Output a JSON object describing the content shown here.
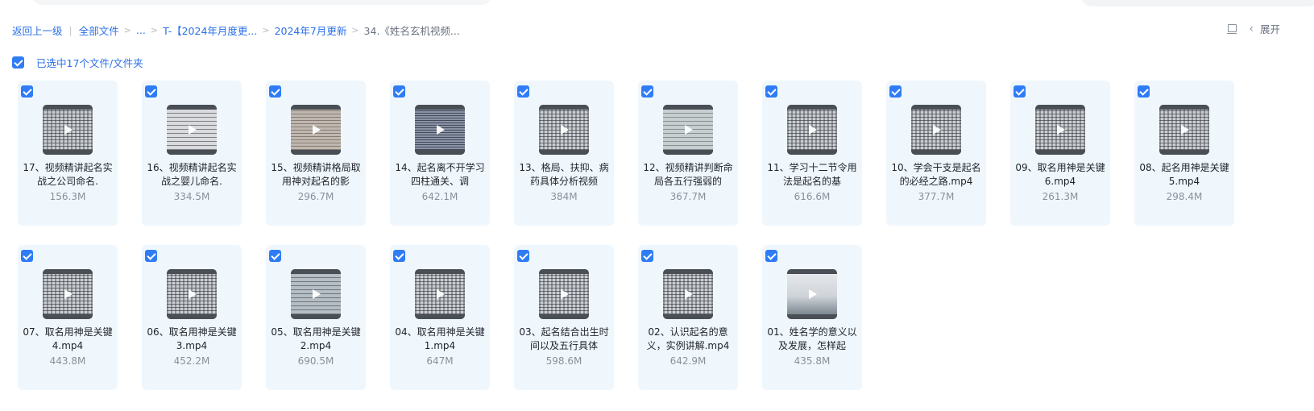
{
  "breadcrumb": {
    "back": "返回上一级",
    "items": [
      "全部文件",
      "...",
      "T-【2024年月度更...",
      "2024年7月更新"
    ],
    "current": "34.《姓名玄机视频..."
  },
  "toolbar": {
    "expand_label": "展开"
  },
  "selection": {
    "label": "已选中17个文件/文件夹"
  },
  "files": [
    {
      "name": "17、视频精讲起名实战之公司命名.",
      "size": "156.3M",
      "thumb": "t1",
      "icon": "video-thumbnail"
    },
    {
      "name": "16、视频精讲起名实战之婴儿命名.",
      "size": "334.5M",
      "thumb": "t2",
      "icon": "video-thumbnail"
    },
    {
      "name": "15、视频精讲格局取用神对起名的影",
      "size": "296.7M",
      "thumb": "t3",
      "icon": "video-thumbnail"
    },
    {
      "name": "14、起名离不开学习四柱通关、调",
      "size": "642.1M",
      "thumb": "t4",
      "icon": "video-thumbnail"
    },
    {
      "name": "13、格局、扶抑、病药具体分析视频",
      "size": "384M",
      "thumb": "t5",
      "icon": "video-thumbnail"
    },
    {
      "name": "12、视频精讲判断命局各五行强弱的",
      "size": "367.7M",
      "thumb": "t6",
      "icon": "video-thumbnail"
    },
    {
      "name": "11、学习十二节令用法是起名的基",
      "size": "616.6M",
      "thumb": "t7",
      "icon": "video-thumbnail"
    },
    {
      "name": "10、学会干支是起名的必经之路.mp4",
      "size": "377.7M",
      "thumb": "t8",
      "icon": "video-thumbnail"
    },
    {
      "name": "09、取名用神是关键6.mp4",
      "size": "261.3M",
      "thumb": "t9",
      "icon": "video-thumbnail"
    },
    {
      "name": "08、起名用神是关键5.mp4",
      "size": "298.4M",
      "thumb": "t10",
      "icon": "video-thumbnail"
    },
    {
      "name": "07、取名用神是关键4.mp4",
      "size": "443.8M",
      "thumb": "t11",
      "icon": "video-thumbnail"
    },
    {
      "name": "06、取名用神是关键3.mp4",
      "size": "452.2M",
      "thumb": "t12",
      "icon": "video-thumbnail"
    },
    {
      "name": "05、取名用神是关键2.mp4",
      "size": "690.5M",
      "thumb": "t13",
      "icon": "video-thumbnail"
    },
    {
      "name": "04、取名用神是关键1.mp4",
      "size": "647M",
      "thumb": "t14",
      "icon": "video-thumbnail"
    },
    {
      "name": "03、起名结合出生时间以及五行具体",
      "size": "598.6M",
      "thumb": "t15",
      "icon": "video-thumbnail"
    },
    {
      "name": "02、认识起名的意义，实例讲解.mp4",
      "size": "642.9M",
      "thumb": "t16",
      "icon": "video-thumbnail"
    },
    {
      "name": "01、姓名学的意义以及发展，怎样起",
      "size": "435.8M",
      "thumb": "t17",
      "icon": "video-thumbnail"
    }
  ],
  "colors": {
    "accent": "#2f7cf6",
    "link": "#2a70e8",
    "card_bg": "#eff7fd"
  }
}
